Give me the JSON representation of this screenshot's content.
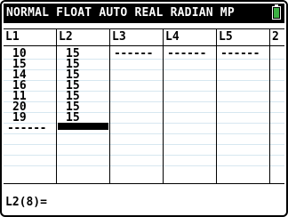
{
  "status_bar": {
    "text": "NORMAL FLOAT AUTO REAL RADIAN MP",
    "battery_color": "#3cb043"
  },
  "columns": [
    {
      "header": "L1",
      "values": [
        "10",
        "15",
        "14",
        "16",
        "11",
        "20",
        "19"
      ],
      "end_marker": "------"
    },
    {
      "header": "L2",
      "values": [
        "15",
        "15",
        "15",
        "15",
        "15",
        "15",
        "15"
      ],
      "end_marker": "------",
      "cursor_row": 8
    },
    {
      "header": "L3",
      "values": [],
      "end_marker": "------"
    },
    {
      "header": "L4",
      "values": [],
      "end_marker": "------"
    },
    {
      "header": "L5",
      "values": [],
      "end_marker": "------"
    },
    {
      "header": "2",
      "values": [],
      "end_marker": ""
    }
  ],
  "entry_line": "L2(8)="
}
